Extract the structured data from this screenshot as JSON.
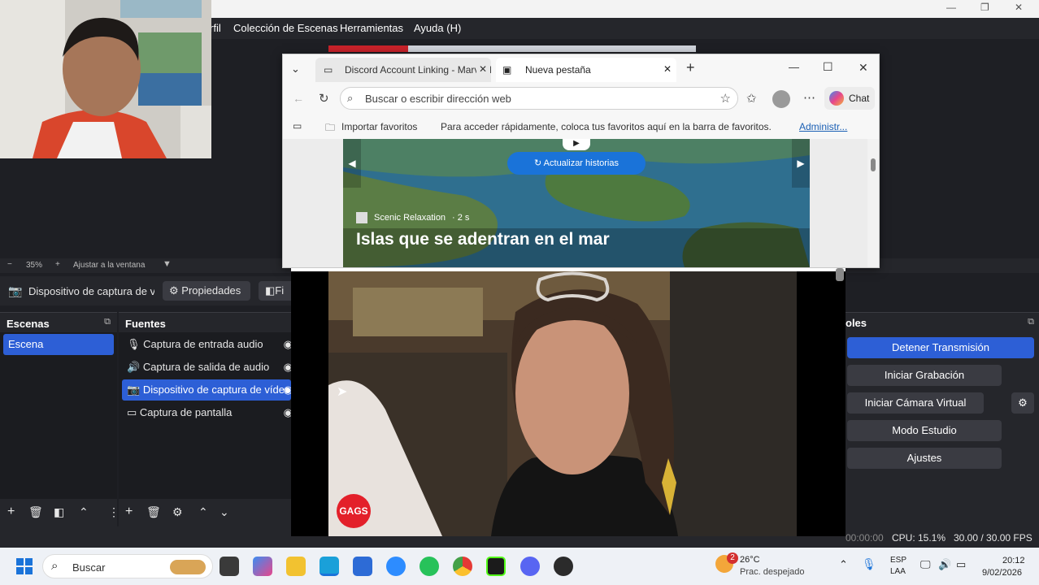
{
  "obs": {
    "menu": {
      "profile_fragment": "rfil",
      "scene_collection": "Colección de Escenas",
      "tools": "Herramientas",
      "help": "Ayuda (H)"
    },
    "zoom": {
      "minus": "−",
      "value": "35%",
      "plus": "+",
      "fit": "Ajustar a la ventana"
    },
    "source_toolbar": {
      "source_name": "Dispositivo de captura de v",
      "properties": "Propiedades",
      "filters_fragment": "Fi"
    },
    "scenes": {
      "title": "Escenas",
      "items": [
        "Escena"
      ]
    },
    "sources": {
      "title": "Fuentes",
      "items": [
        {
          "label": "Captura de entrada audio",
          "icon": "microphone-icon"
        },
        {
          "label": "Captura de salida de audio",
          "icon": "speaker-icon"
        },
        {
          "label": "Dispositivo de captura de vídeo",
          "icon": "camera-icon"
        },
        {
          "label": "Captura de pantalla",
          "icon": "monitor-icon"
        }
      ]
    },
    "controls": {
      "title_fragment": "oles",
      "stop_stream": "Detener Transmisión",
      "start_recording": "Iniciar Grabación",
      "start_virtual_cam": "Iniciar Cámara Virtual",
      "studio_mode": "Modo Estudio",
      "settings": "Ajustes"
    },
    "status": {
      "time": "00:00:00",
      "cpu": "CPU: 15.1%",
      "fps": "30.00 / 30.00 FPS"
    },
    "colors": {
      "accent": "#2d5fd6",
      "panel": "#25262b",
      "background": "#1e1f24"
    }
  },
  "browser": {
    "tabs": [
      {
        "label": "Discord Account Linking - Marvel R",
        "active": false
      },
      {
        "label": "Nueva pestaña",
        "active": true
      }
    ],
    "address_placeholder": "Buscar o escribir dirección web",
    "chat": "Chat",
    "favorites": {
      "import": "Importar favoritos",
      "hint": "Para acceder rápidamente, coloca tus favoritos aquí en la barra de favoritos.",
      "manage": "Administr..."
    },
    "story": {
      "refresh": "Actualizar historias",
      "source": "Scenic Relaxation",
      "age": "· 2 s",
      "title": "Islas que se adentran en el mar"
    }
  },
  "video": {
    "logo": "GAGS"
  },
  "taskbar": {
    "search": "Buscar",
    "weather_badge": "2",
    "temperature": "26°C",
    "weather": "Prac. despejado",
    "lang1": "ESP",
    "lang2": "LAA",
    "time": "20:12",
    "date": "9/02/2026"
  }
}
